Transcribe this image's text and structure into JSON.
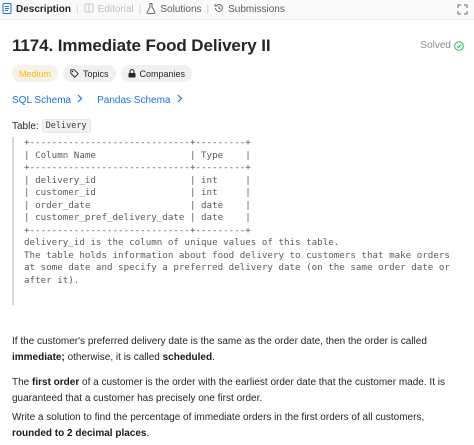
{
  "tabs": [
    {
      "label": "Description",
      "icon": "document-icon",
      "active": true
    },
    {
      "label": "Editorial",
      "icon": "book-icon",
      "disabled": true
    },
    {
      "label": "Solutions",
      "icon": "flask-icon"
    },
    {
      "label": "Submissions",
      "icon": "history-icon"
    }
  ],
  "problem": {
    "title": "1174. Immediate Food Delivery II",
    "status": "Solved",
    "status_color": "#2cbb5d"
  },
  "badges": {
    "difficulty": "Medium",
    "difficulty_color": "#ffb800",
    "topics": "Topics",
    "companies": "Companies"
  },
  "schemas": [
    "SQL Schema",
    "Pandas Schema"
  ],
  "table_label": {
    "prefix": "Table:",
    "name": "Delivery"
  },
  "schema_block": [
    "+-----------------------------+---------+",
    "| Column Name                 | Type    |",
    "+-----------------------------+---------+",
    "| delivery_id                 | int     |",
    "| customer_id                 | int     |",
    "| order_date                  | date    |",
    "| customer_pref_delivery_date | date    |",
    "+-----------------------------+---------+",
    "delivery_id is the column of unique values of this table.",
    "The table holds information about food delivery to customers that make orders",
    "at some date and specify a preferred delivery date (on the same order date or",
    "after it)."
  ],
  "paragraphs": {
    "p1_a": "If the customer's preferred delivery date is the same as the order date, then the order is called ",
    "p1_b": "immediate;",
    "p1_c": " otherwise, it is called ",
    "p1_d": "scheduled",
    "p1_e": ".",
    "p2_a": "The ",
    "p2_b": "first order",
    "p2_c": " of a customer is the order with the earliest order date that the customer made. It is guaranteed that a customer has precisely one first order.",
    "p3_a": "Write a solution to find the percentage of immediate orders in the first orders of all customers, ",
    "p3_b": "rounded to 2 decimal places",
    "p3_c": "."
  }
}
